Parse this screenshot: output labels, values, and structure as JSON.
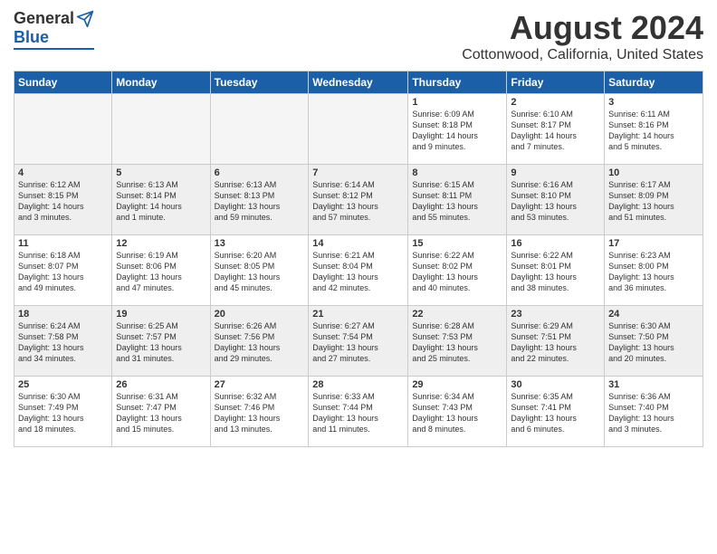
{
  "logo": {
    "general": "General",
    "blue": "Blue"
  },
  "title": "August 2024",
  "subtitle": "Cottonwood, California, United States",
  "weekdays": [
    "Sunday",
    "Monday",
    "Tuesday",
    "Wednesday",
    "Thursday",
    "Friday",
    "Saturday"
  ],
  "weeks": [
    [
      {
        "day": "",
        "info": ""
      },
      {
        "day": "",
        "info": ""
      },
      {
        "day": "",
        "info": ""
      },
      {
        "day": "",
        "info": ""
      },
      {
        "day": "1",
        "info": "Sunrise: 6:09 AM\nSunset: 8:18 PM\nDaylight: 14 hours\nand 9 minutes."
      },
      {
        "day": "2",
        "info": "Sunrise: 6:10 AM\nSunset: 8:17 PM\nDaylight: 14 hours\nand 7 minutes."
      },
      {
        "day": "3",
        "info": "Sunrise: 6:11 AM\nSunset: 8:16 PM\nDaylight: 14 hours\nand 5 minutes."
      }
    ],
    [
      {
        "day": "4",
        "info": "Sunrise: 6:12 AM\nSunset: 8:15 PM\nDaylight: 14 hours\nand 3 minutes."
      },
      {
        "day": "5",
        "info": "Sunrise: 6:13 AM\nSunset: 8:14 PM\nDaylight: 14 hours\nand 1 minute."
      },
      {
        "day": "6",
        "info": "Sunrise: 6:13 AM\nSunset: 8:13 PM\nDaylight: 13 hours\nand 59 minutes."
      },
      {
        "day": "7",
        "info": "Sunrise: 6:14 AM\nSunset: 8:12 PM\nDaylight: 13 hours\nand 57 minutes."
      },
      {
        "day": "8",
        "info": "Sunrise: 6:15 AM\nSunset: 8:11 PM\nDaylight: 13 hours\nand 55 minutes."
      },
      {
        "day": "9",
        "info": "Sunrise: 6:16 AM\nSunset: 8:10 PM\nDaylight: 13 hours\nand 53 minutes."
      },
      {
        "day": "10",
        "info": "Sunrise: 6:17 AM\nSunset: 8:09 PM\nDaylight: 13 hours\nand 51 minutes."
      }
    ],
    [
      {
        "day": "11",
        "info": "Sunrise: 6:18 AM\nSunset: 8:07 PM\nDaylight: 13 hours\nand 49 minutes."
      },
      {
        "day": "12",
        "info": "Sunrise: 6:19 AM\nSunset: 8:06 PM\nDaylight: 13 hours\nand 47 minutes."
      },
      {
        "day": "13",
        "info": "Sunrise: 6:20 AM\nSunset: 8:05 PM\nDaylight: 13 hours\nand 45 minutes."
      },
      {
        "day": "14",
        "info": "Sunrise: 6:21 AM\nSunset: 8:04 PM\nDaylight: 13 hours\nand 42 minutes."
      },
      {
        "day": "15",
        "info": "Sunrise: 6:22 AM\nSunset: 8:02 PM\nDaylight: 13 hours\nand 40 minutes."
      },
      {
        "day": "16",
        "info": "Sunrise: 6:22 AM\nSunset: 8:01 PM\nDaylight: 13 hours\nand 38 minutes."
      },
      {
        "day": "17",
        "info": "Sunrise: 6:23 AM\nSunset: 8:00 PM\nDaylight: 13 hours\nand 36 minutes."
      }
    ],
    [
      {
        "day": "18",
        "info": "Sunrise: 6:24 AM\nSunset: 7:58 PM\nDaylight: 13 hours\nand 34 minutes."
      },
      {
        "day": "19",
        "info": "Sunrise: 6:25 AM\nSunset: 7:57 PM\nDaylight: 13 hours\nand 31 minutes."
      },
      {
        "day": "20",
        "info": "Sunrise: 6:26 AM\nSunset: 7:56 PM\nDaylight: 13 hours\nand 29 minutes."
      },
      {
        "day": "21",
        "info": "Sunrise: 6:27 AM\nSunset: 7:54 PM\nDaylight: 13 hours\nand 27 minutes."
      },
      {
        "day": "22",
        "info": "Sunrise: 6:28 AM\nSunset: 7:53 PM\nDaylight: 13 hours\nand 25 minutes."
      },
      {
        "day": "23",
        "info": "Sunrise: 6:29 AM\nSunset: 7:51 PM\nDaylight: 13 hours\nand 22 minutes."
      },
      {
        "day": "24",
        "info": "Sunrise: 6:30 AM\nSunset: 7:50 PM\nDaylight: 13 hours\nand 20 minutes."
      }
    ],
    [
      {
        "day": "25",
        "info": "Sunrise: 6:30 AM\nSunset: 7:49 PM\nDaylight: 13 hours\nand 18 minutes."
      },
      {
        "day": "26",
        "info": "Sunrise: 6:31 AM\nSunset: 7:47 PM\nDaylight: 13 hours\nand 15 minutes."
      },
      {
        "day": "27",
        "info": "Sunrise: 6:32 AM\nSunset: 7:46 PM\nDaylight: 13 hours\nand 13 minutes."
      },
      {
        "day": "28",
        "info": "Sunrise: 6:33 AM\nSunset: 7:44 PM\nDaylight: 13 hours\nand 11 minutes."
      },
      {
        "day": "29",
        "info": "Sunrise: 6:34 AM\nSunset: 7:43 PM\nDaylight: 13 hours\nand 8 minutes."
      },
      {
        "day": "30",
        "info": "Sunrise: 6:35 AM\nSunset: 7:41 PM\nDaylight: 13 hours\nand 6 minutes."
      },
      {
        "day": "31",
        "info": "Sunrise: 6:36 AM\nSunset: 7:40 PM\nDaylight: 13 hours\nand 3 minutes."
      }
    ]
  ]
}
